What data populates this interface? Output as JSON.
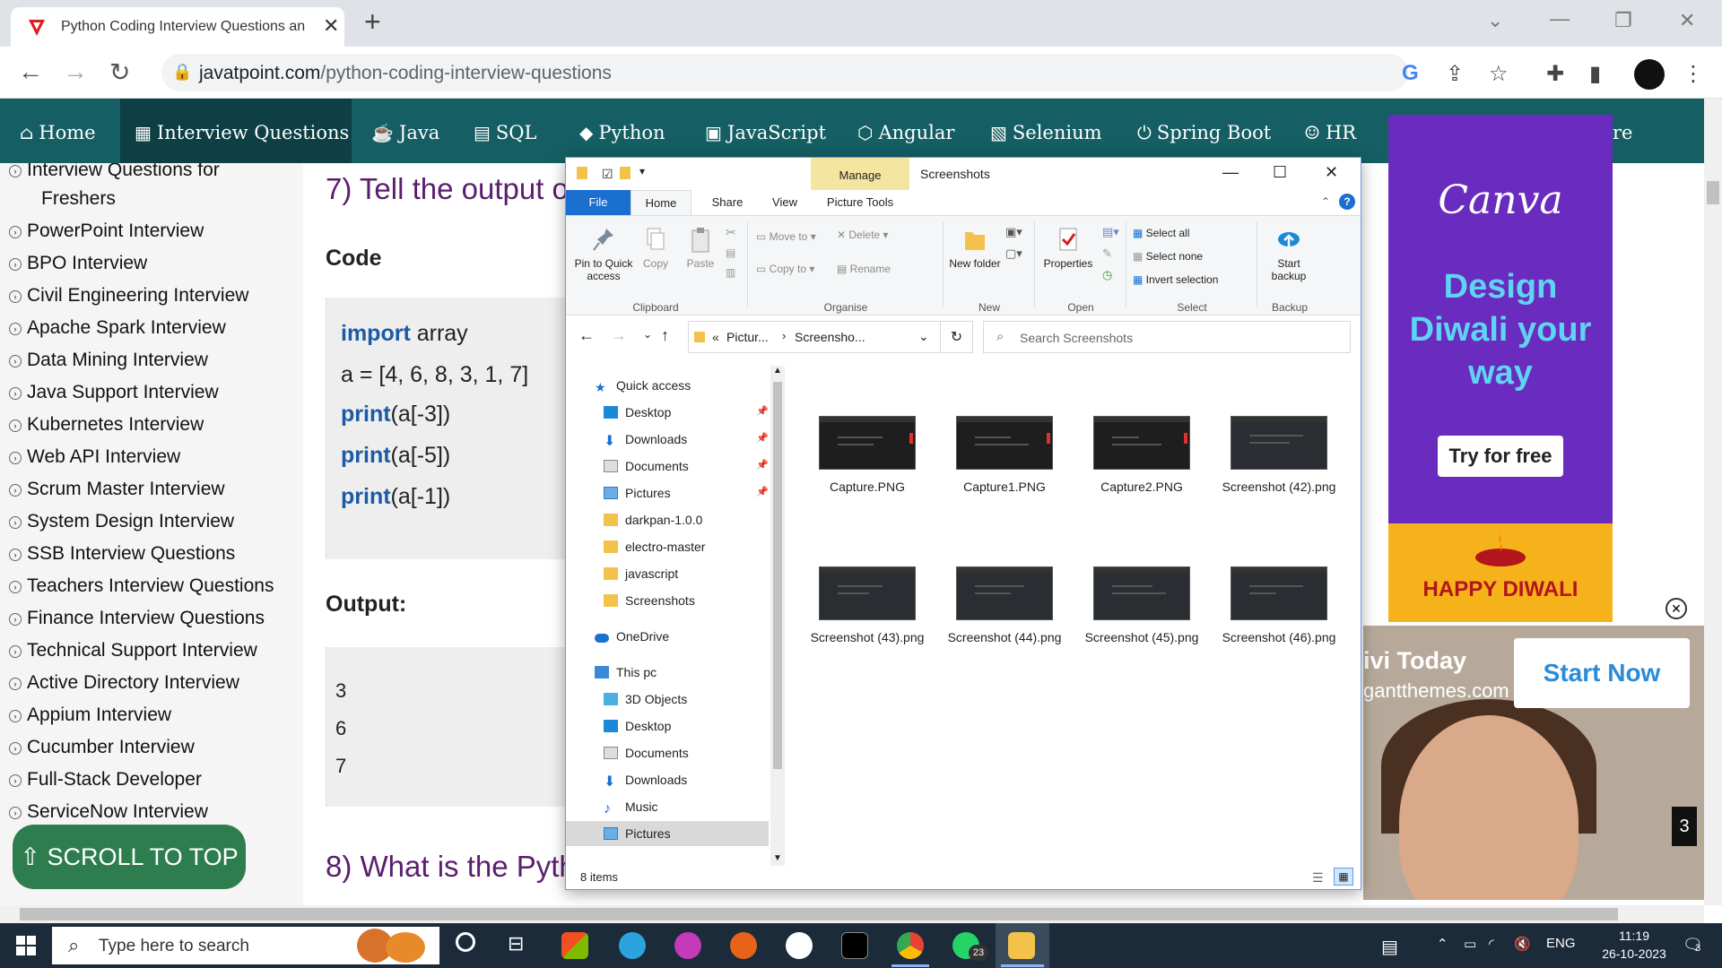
{
  "browser": {
    "tab_title": "Python Coding Interview Questions an",
    "new_tab": "+",
    "url_host": "javatpoint.com",
    "url_path": "/python-coding-interview-questions"
  },
  "site_nav": {
    "items": [
      {
        "label": "Home"
      },
      {
        "label": "Interview Questions"
      },
      {
        "label": "Java"
      },
      {
        "label": "SQL"
      },
      {
        "label": "Python"
      },
      {
        "label": "JavaScript"
      },
      {
        "label": "Angular"
      },
      {
        "label": "Selenium"
      },
      {
        "label": "Spring Boot"
      },
      {
        "label": "HR"
      },
      {
        "label": "re"
      }
    ]
  },
  "sidebar": {
    "items": [
      "Interview Questions for",
      "Freshers",
      "PowerPoint Interview",
      "BPO Interview",
      "Civil Engineering Interview",
      "Apache Spark Interview",
      "Data Mining Interview",
      "Java Support Interview",
      "Kubernetes Interview",
      "Web API Interview",
      "Scrum Master Interview",
      "System Design Interview",
      "SSB Interview Questions",
      "Teachers Interview Questions",
      "Finance Interview Questions",
      "Technical Support Interview",
      "Active Directory Interview",
      "Appium Interview",
      "Cucumber Interview",
      "Full-Stack Developer",
      "ServiceNow Interview"
    ],
    "scroll_top": "⇧ SCROLL TO TOP"
  },
  "article": {
    "q7_heading": "7) Tell the output o",
    "code_label": "Code",
    "code": {
      "import_kw": "import",
      "import_rest": " array",
      "line2": "a = [4, 6, 8, 3, 1, 7]",
      "print_kw": "print",
      "p1": "(a[-3])",
      "p2": "(a[-5])",
      "p3": "(a[-1])"
    },
    "output_label": "Output:",
    "output": [
      "3",
      "6",
      "7"
    ],
    "q8_heading": "8) What is the Pyth"
  },
  "ads": {
    "canva_logo": "Canva",
    "canva_tagline_1": "Design",
    "canva_tagline_2": "Diwali your",
    "canva_tagline_3": "way",
    "canva_button": "Try for free",
    "canva_banner": "HAPPY DIWALI",
    "divi_line1": "ivi Today",
    "divi_line2": "gantthemes.com",
    "divi_button": "Start Now",
    "badge": "3"
  },
  "explorer": {
    "title": "Screenshots",
    "manage_tab": "Manage",
    "tabs": [
      "File",
      "Home",
      "Share",
      "View",
      "Picture Tools"
    ],
    "ribbon": {
      "pin": "Pin to Quick access",
      "copy": "Copy",
      "paste": "Paste",
      "move_to": "Move to",
      "delete": "Delete",
      "copy_to": "Copy to",
      "rename": "Rename",
      "new_folder": "New folder",
      "properties": "Properties",
      "select_all": "Select all",
      "select_none": "Select none",
      "invert_selection": "Invert selection",
      "start_backup": "Start backup",
      "groups": {
        "clipboard": "Clipboard",
        "organise": "Organise",
        "new": "New",
        "open": "Open",
        "select": "Select",
        "backup": "Backup"
      }
    },
    "address": {
      "crumb_prefix": "«",
      "crumb1": "Pictur...",
      "crumb2": "Screensho...",
      "search_placeholder": "Search Screenshots"
    },
    "nav": {
      "quick_access": "Quick access",
      "qa_items": [
        "Desktop",
        "Downloads",
        "Documents",
        "Pictures",
        "darkpan-1.0.0",
        "electro-master",
        "javascript",
        "Screenshots"
      ],
      "onedrive": "OneDrive",
      "this_pc": "This pc",
      "pc_items": [
        "3D Objects",
        "Desktop",
        "Documents",
        "Downloads",
        "Music",
        "Pictures"
      ]
    },
    "files": [
      {
        "name": "Capture.PNG"
      },
      {
        "name": "Capture1.PNG"
      },
      {
        "name": "Capture2.PNG"
      },
      {
        "name": "Screenshot (42).png"
      },
      {
        "name": "Screenshot (43).png"
      },
      {
        "name": "Screenshot (44).png"
      },
      {
        "name": "Screenshot (45).png"
      },
      {
        "name": "Screenshot (46).png"
      }
    ],
    "status": "8 items"
  },
  "taskbar": {
    "search_placeholder": "Type here to search",
    "lang": "ENG",
    "time": "11:19",
    "date": "26-10-2023",
    "whatsapp_badge": "23",
    "notif_count": "3"
  },
  "colors": {
    "site_nav": "#155e63",
    "nav_active": "#0d3f44",
    "heading": "#5a1e6e",
    "keyword": "#1c5aa6",
    "scroll_top": "#2e7d4f",
    "explorer_file_tab": "#1a6fcf",
    "canva_bg": "#6a2bbf"
  }
}
